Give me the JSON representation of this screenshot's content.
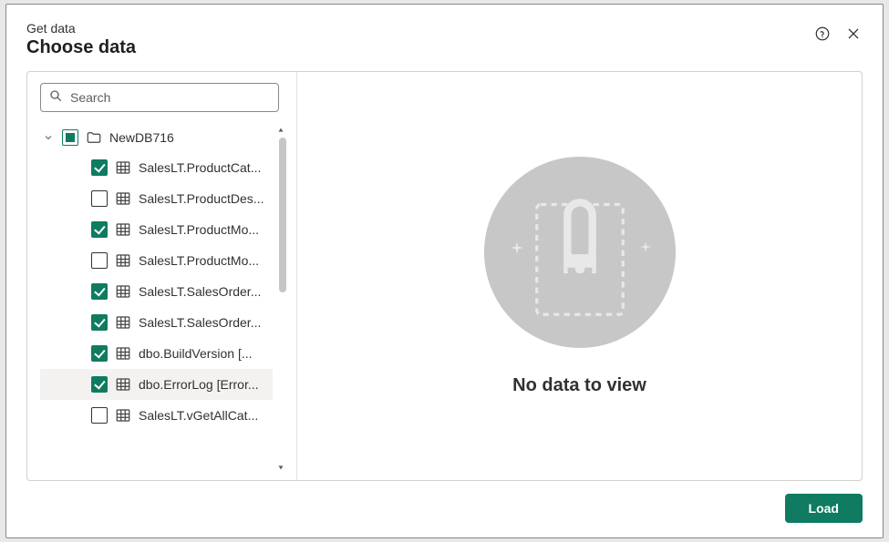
{
  "header": {
    "subtitle": "Get data",
    "title": "Choose data"
  },
  "search": {
    "placeholder": "Search",
    "value": ""
  },
  "tree": {
    "database": {
      "name": "NewDB716",
      "expanded": true,
      "check_state": "mixed"
    },
    "tables": [
      {
        "label": "SalesLT.ProductCat...",
        "checked": true,
        "selected": false
      },
      {
        "label": "SalesLT.ProductDes...",
        "checked": false,
        "selected": false
      },
      {
        "label": "SalesLT.ProductMo...",
        "checked": true,
        "selected": false
      },
      {
        "label": "SalesLT.ProductMo...",
        "checked": false,
        "selected": false
      },
      {
        "label": "SalesLT.SalesOrder...",
        "checked": true,
        "selected": false
      },
      {
        "label": "SalesLT.SalesOrder...",
        "checked": true,
        "selected": false
      },
      {
        "label": "dbo.BuildVersion [...",
        "checked": true,
        "selected": false
      },
      {
        "label": "dbo.ErrorLog [Error...",
        "checked": true,
        "selected": true
      },
      {
        "label": "SalesLT.vGetAllCat...",
        "checked": false,
        "selected": false
      }
    ]
  },
  "preview": {
    "empty_message": "No data to view"
  },
  "footer": {
    "load_label": "Load"
  }
}
